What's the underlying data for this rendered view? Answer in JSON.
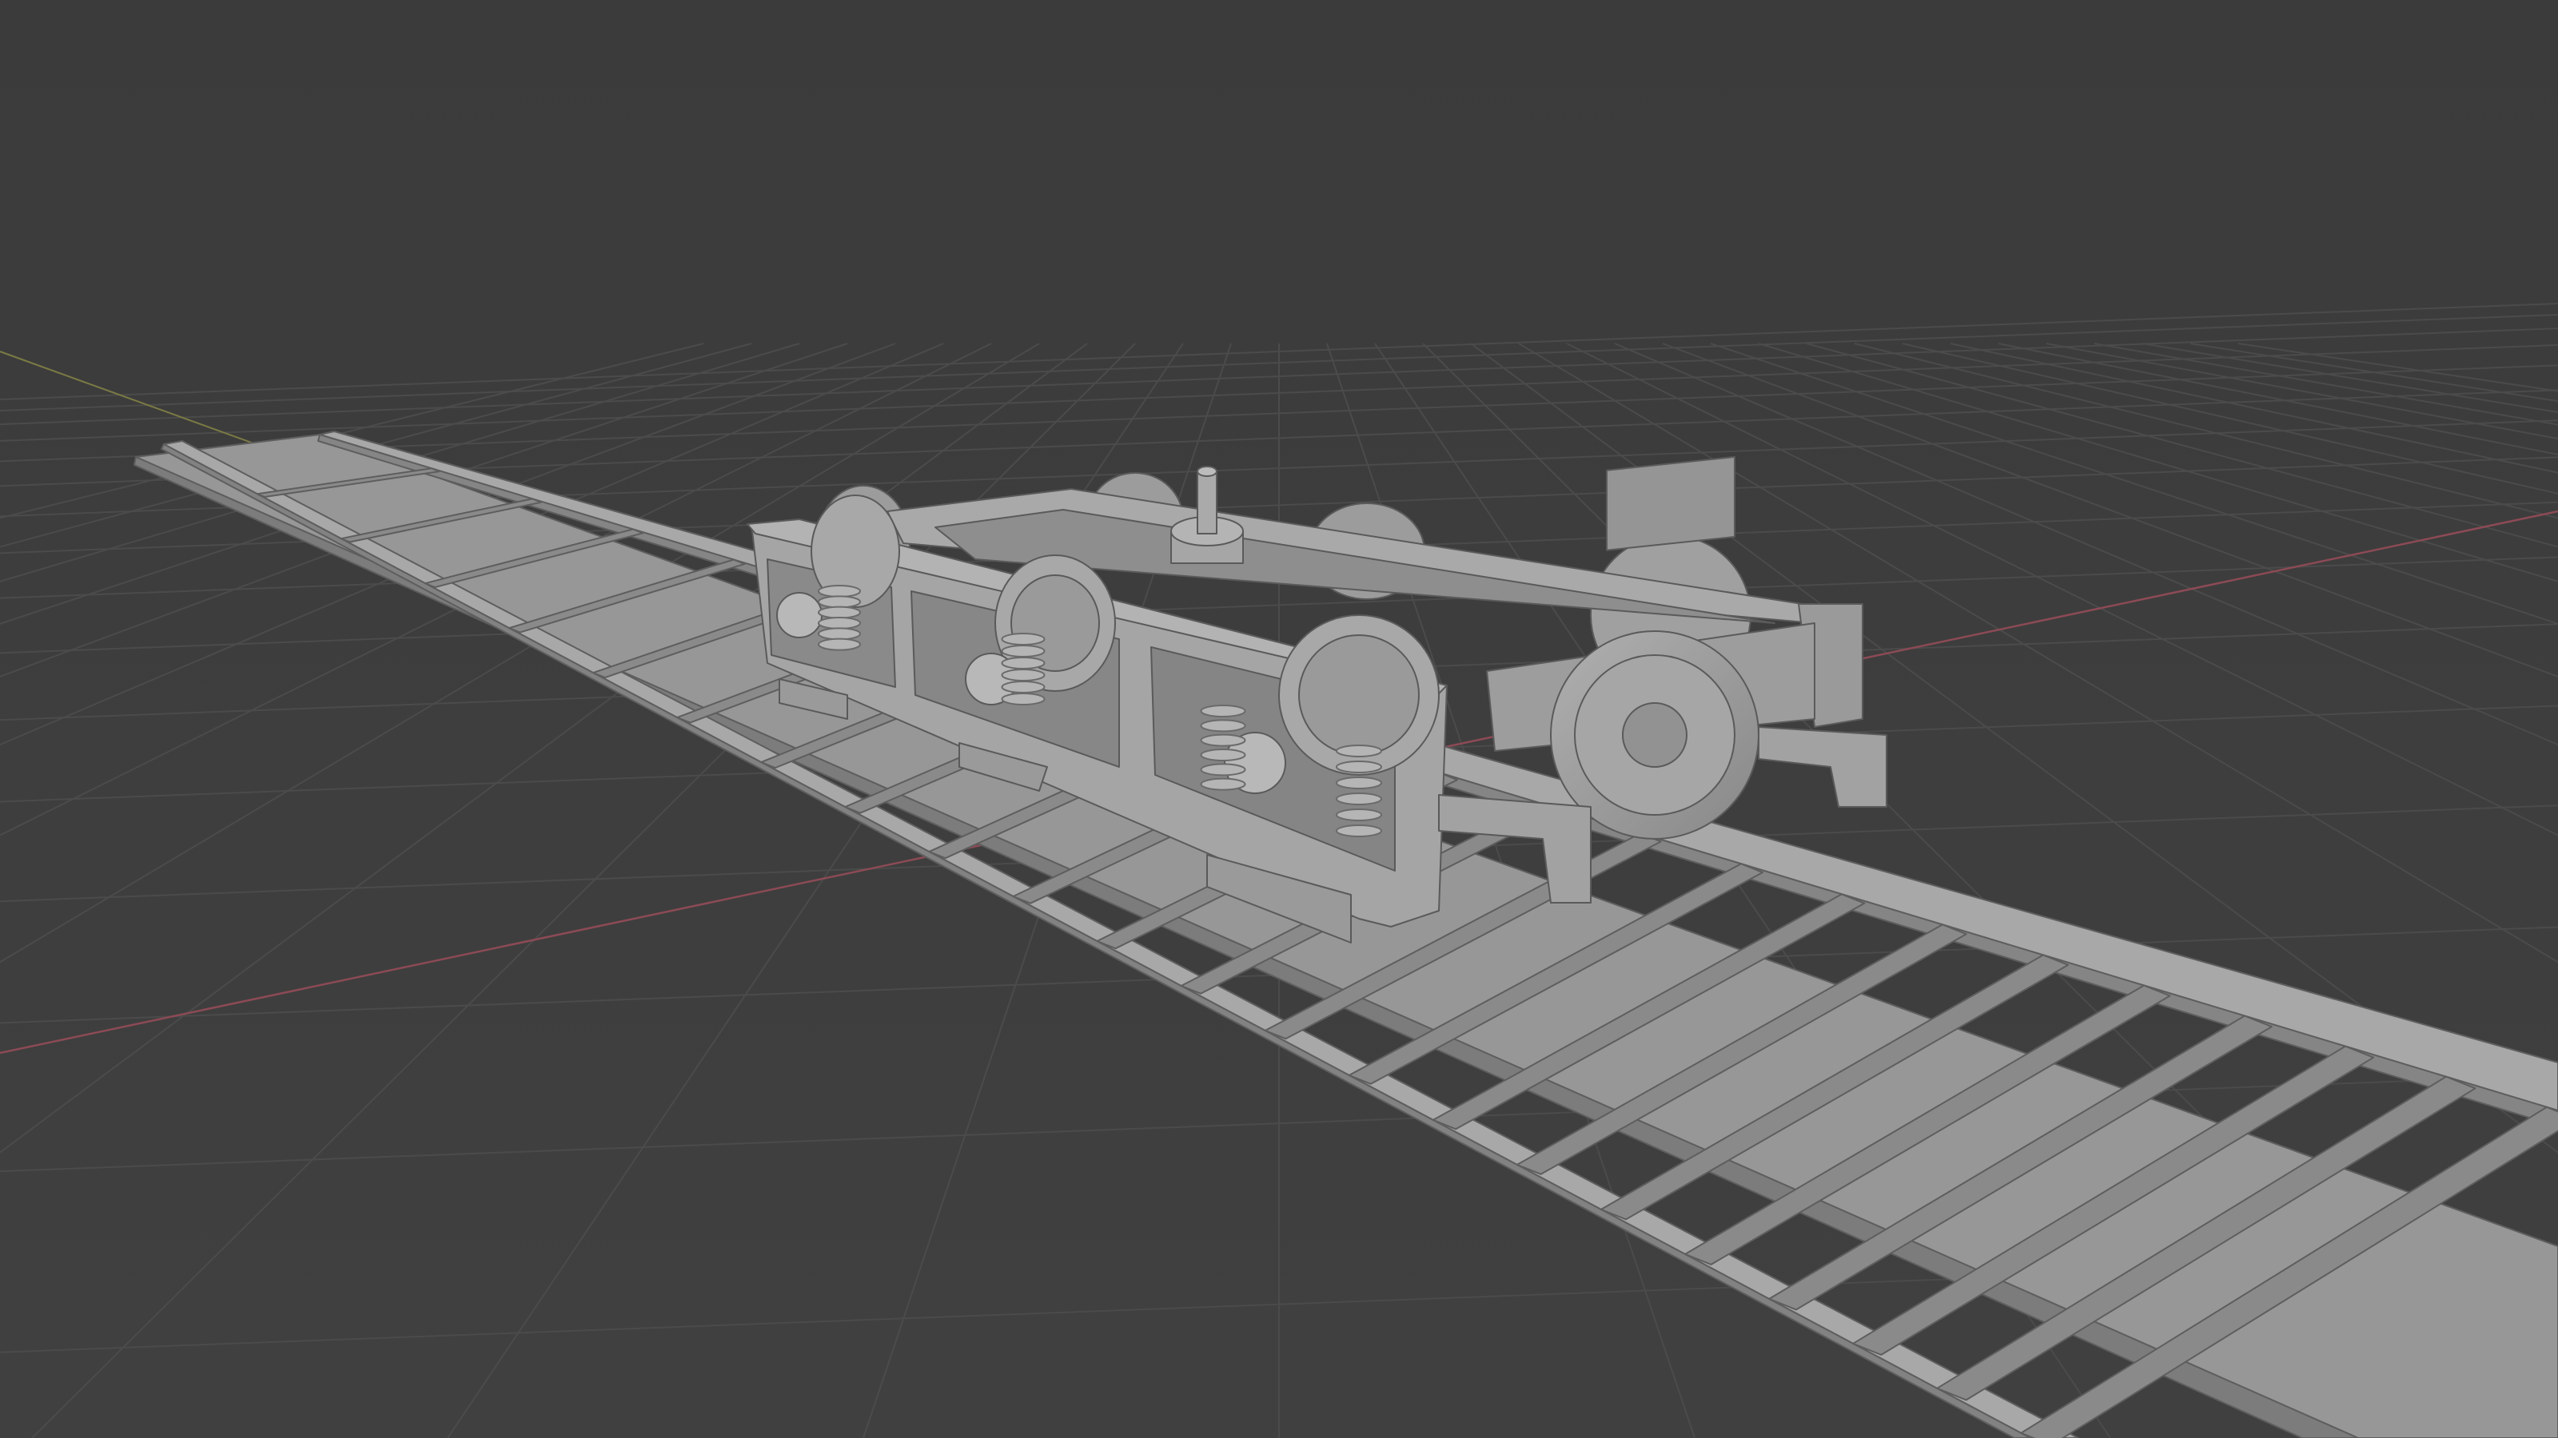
{
  "viewport": {
    "background_color": "#3d3d3d",
    "grid_color": "#4a4a4a",
    "x_axis_color": "#a0505a",
    "y_axis_color": "#8a8a50",
    "model_face_light": "#a3a3a3",
    "model_face_mid": "#939393",
    "model_face_dark": "#7e7e7e",
    "model_edge": "#5e5e5e",
    "objects": [
      "rail-track",
      "bogie-frame",
      "wheelset-front",
      "wheelset-rear",
      "suspension-springs",
      "center-pivot"
    ]
  }
}
